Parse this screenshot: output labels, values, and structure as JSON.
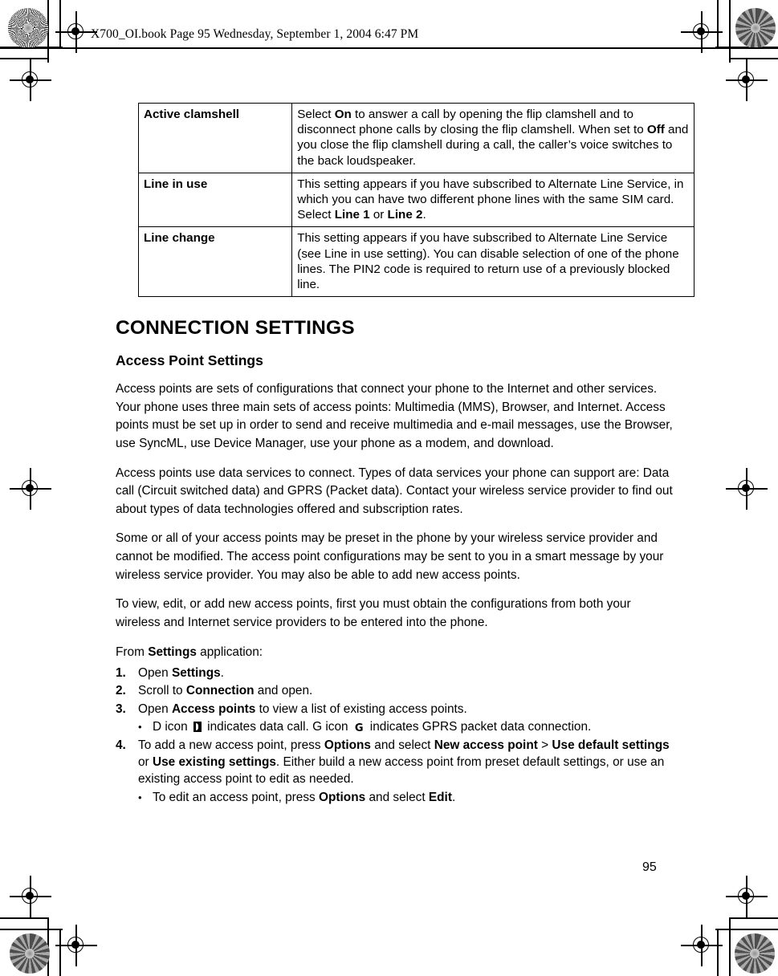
{
  "header": {
    "file_line": "X700_OI.book  Page 95  Wednesday, September 1, 2004  6:47 PM"
  },
  "table": {
    "rows": [
      {
        "term": "Active clamshell",
        "desc_parts": [
          {
            "t": "Select ",
            "b": false
          },
          {
            "t": "On",
            "b": true
          },
          {
            "t": " to answer a call by opening the flip clamshell and to disconnect phone calls by closing the flip clamshell. When set to ",
            "b": false
          },
          {
            "t": "Off",
            "b": true
          },
          {
            "t": " and you close the flip clamshell during a call, the caller’s voice switches to the back loudspeaker.",
            "b": false
          }
        ]
      },
      {
        "term": "Line in use",
        "desc_parts": [
          {
            "t": "This setting appears if you have subscribed to Alternate Line Service, in which you can have two different phone lines with the same SIM card. Select ",
            "b": false
          },
          {
            "t": "Line 1",
            "b": true
          },
          {
            "t": " or ",
            "b": false
          },
          {
            "t": "Line 2",
            "b": true
          },
          {
            "t": ".",
            "b": false
          }
        ]
      },
      {
        "term": "Line change",
        "desc_parts": [
          {
            "t": "This setting appears if you have subscribed to Alternate Line Service (see Line in use setting). You can disable selection of one of the phone lines. The PIN2 code is required to return use of a previously blocked line.",
            "b": false
          }
        ]
      }
    ]
  },
  "section": {
    "title": "CONNECTION SETTINGS",
    "subtitle": "Access Point Settings"
  },
  "paragraphs": [
    "Access points are sets of configurations that connect your phone to the Internet and other services. Your phone uses three main sets of access points: Multimedia (MMS), Browser, and Internet. Access points must be set up in order to send and receive multimedia and e-mail messages, use the Browser, use SyncML, use Device Manager, use your phone as a modem, and download.",
    "Access points use data services to connect. Types of data services your phone can support are: Data call (Circuit switched data) and GPRS (Packet data). Contact your wireless service provider to find out about types of data technologies offered and subscription rates.",
    "Some or all of your access points may be preset in the phone by your wireless service provider and cannot be modified. The access point configurations may be sent to you in a smart message by your wireless service provider. You may also be able to add new access points.",
    "To view, edit, or add new access points, first you must obtain the configurations from both your wireless and Internet service providers to be entered into the phone."
  ],
  "from_line": {
    "parts": [
      {
        "t": "From ",
        "b": false
      },
      {
        "t": "Settings",
        "b": true
      },
      {
        "t": " application:",
        "b": false
      }
    ]
  },
  "steps": [
    {
      "num": "1.",
      "parts": [
        {
          "t": "Open ",
          "b": false
        },
        {
          "t": "Settings",
          "b": true
        },
        {
          "t": ".",
          "b": false
        }
      ],
      "bullets": []
    },
    {
      "num": "2.",
      "parts": [
        {
          "t": "Scroll to ",
          "b": false
        },
        {
          "t": "Connection",
          "b": true
        },
        {
          "t": " and open.",
          "b": false
        }
      ],
      "bullets": []
    },
    {
      "num": "3.",
      "parts": [
        {
          "t": "Open ",
          "b": false
        },
        {
          "t": "Access points",
          "b": true
        },
        {
          "t": " to view a list of existing access points.",
          "b": false
        }
      ],
      "bullets": [
        {
          "dot": "•",
          "parts": [
            {
              "t": "D icon ",
              "b": false
            },
            {
              "icon": "data-call-icon"
            },
            {
              "t": " indicates data call. G icon ",
              "b": false
            },
            {
              "icon": "gprs-icon",
              "glyph": "G"
            },
            {
              "t": " indicates GPRS packet data connection.",
              "b": false
            }
          ]
        }
      ]
    },
    {
      "num": "4.",
      "parts": [
        {
          "t": "To add a new access point, press ",
          "b": false
        },
        {
          "t": "Options",
          "b": true
        },
        {
          "t": " and select ",
          "b": false
        },
        {
          "t": "New access point",
          "b": true
        },
        {
          "t": " > ",
          "b": false
        },
        {
          "t": "Use default settings",
          "b": true
        },
        {
          "t": " or ",
          "b": false
        },
        {
          "t": "Use existing settings",
          "b": true
        },
        {
          "t": ". Either build a new access point from preset default settings, or use an existing access point to edit as needed.",
          "b": false
        }
      ],
      "bullets": [
        {
          "dot": "•",
          "parts": [
            {
              "t": "To edit an access point, press ",
              "b": false
            },
            {
              "t": "Options",
              "b": true
            },
            {
              "t": " and select ",
              "b": false
            },
            {
              "t": "Edit",
              "b": true
            },
            {
              "t": ".",
              "b": false
            }
          ]
        }
      ]
    }
  ],
  "footer": {
    "page_number": "95"
  },
  "colors": {
    "ink": "#000000",
    "paper": "#ffffff"
  }
}
